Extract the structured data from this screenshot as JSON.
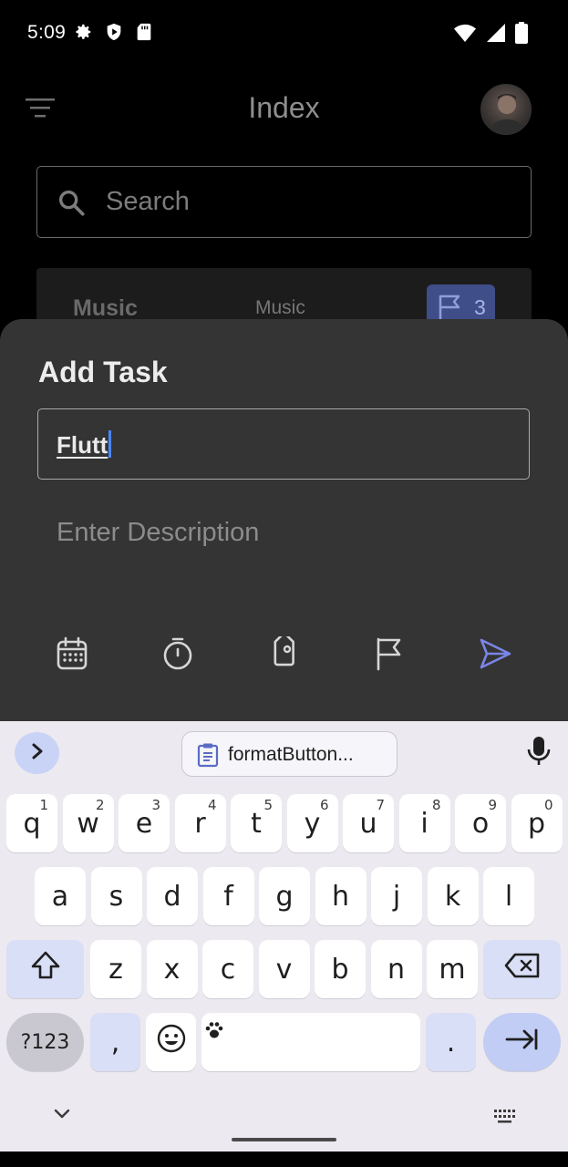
{
  "status_bar": {
    "time": "5:09",
    "left_icons": [
      "gear-icon",
      "shield-icon",
      "sd-card-icon"
    ],
    "right_icons": [
      "wifi-icon",
      "cell-signal-icon",
      "battery-icon"
    ]
  },
  "app": {
    "title": "Index",
    "search_placeholder": "Search",
    "card": {
      "name": "Music",
      "category": "Music",
      "count": "3"
    }
  },
  "sheet": {
    "heading": "Add Task",
    "task_value": "Flutt",
    "description_placeholder": "Enter Description",
    "tools": [
      "calendar-icon",
      "timer-icon",
      "tag-icon",
      "flag-icon",
      "send-icon"
    ],
    "accent": "#7b86e8"
  },
  "keyboard": {
    "clipboard_text": "formatButton...",
    "rows": [
      [
        {
          "k": "q",
          "h": "1"
        },
        {
          "k": "w",
          "h": "2"
        },
        {
          "k": "e",
          "h": "3"
        },
        {
          "k": "r",
          "h": "4"
        },
        {
          "k": "t",
          "h": "5"
        },
        {
          "k": "y",
          "h": "6"
        },
        {
          "k": "u",
          "h": "7"
        },
        {
          "k": "i",
          "h": "8"
        },
        {
          "k": "o",
          "h": "9"
        },
        {
          "k": "p",
          "h": "0"
        }
      ],
      [
        {
          "k": "a"
        },
        {
          "k": "s"
        },
        {
          "k": "d"
        },
        {
          "k": "f"
        },
        {
          "k": "g"
        },
        {
          "k": "h"
        },
        {
          "k": "j"
        },
        {
          "k": "k"
        },
        {
          "k": "l"
        }
      ],
      [
        {
          "k": "z"
        },
        {
          "k": "x"
        },
        {
          "k": "c"
        },
        {
          "k": "v"
        },
        {
          "k": "b"
        },
        {
          "k": "n"
        },
        {
          "k": "m"
        }
      ]
    ],
    "symbols_label": "?123",
    "comma": ",",
    "period": "."
  }
}
